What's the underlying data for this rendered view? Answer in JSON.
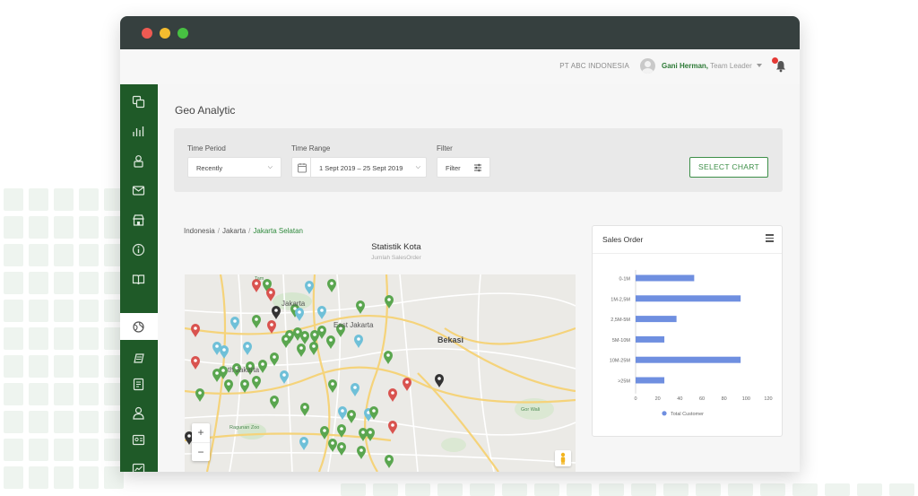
{
  "topbar": {
    "company": "PT ABC INDONESIA",
    "user_name": "Gani Herman,",
    "user_role": " Team Leader"
  },
  "sidebar": {
    "items": [
      {
        "icon": "copy-icon",
        "active": false
      },
      {
        "icon": "bar-chart-icon",
        "active": false
      },
      {
        "icon": "user-lock-icon",
        "active": false
      },
      {
        "icon": "mail-icon",
        "active": false
      },
      {
        "icon": "store-icon",
        "active": false
      },
      {
        "icon": "info-icon",
        "active": false
      },
      {
        "icon": "book-icon",
        "active": false
      },
      {
        "icon": "globe-icon",
        "active": true
      },
      {
        "icon": "money-icon",
        "active": false
      },
      {
        "icon": "document-icon",
        "active": false
      },
      {
        "icon": "person-icon",
        "active": false
      },
      {
        "icon": "id-card-icon",
        "active": false
      },
      {
        "icon": "report-icon",
        "active": false
      }
    ]
  },
  "page": {
    "title": "Geo Analytic"
  },
  "filters": {
    "time_period_label": "Time Period",
    "time_period_value": "Recently",
    "time_range_label": "Time Range",
    "time_range_value": "1 Sept 2019 – 25 Sept 2019",
    "filter_label": "Filter",
    "filter_button": "Filter",
    "select_chart": "SELECT CHART"
  },
  "breadcrumb": [
    "Indonesia",
    "Jakarta",
    "Jakarta Selatan"
  ],
  "map": {
    "title": "Statistik Kota",
    "subtitle": "Jumlah SalesOrder",
    "labels": {
      "jakarta": "Jakarta",
      "east_jakarta": "East Jakarta",
      "bekasi": "Bekasi",
      "south_jakarta": "th Jakarta",
      "ragunan": "Ragunan Zoo",
      "gor": "Gor Wali",
      "taman": "Tam"
    },
    "zoom_in": "+",
    "zoom_out": "−"
  },
  "chart_data": {
    "type": "bar",
    "orientation": "horizontal",
    "title": "Sales Order",
    "categories": [
      "0-1M",
      "1M-2,5M",
      "2,5M-5M",
      "5M-10M",
      "10M-25M",
      ">25M"
    ],
    "series": [
      {
        "name": "Total Customer",
        "values": [
          53,
          95,
          37,
          26,
          95,
          26
        ]
      }
    ],
    "xlim": [
      0,
      120
    ],
    "xticks": [
      0,
      20,
      40,
      60,
      80,
      100,
      120
    ],
    "color": "#6f8fe0",
    "legend": "bottom",
    "grid": false
  }
}
